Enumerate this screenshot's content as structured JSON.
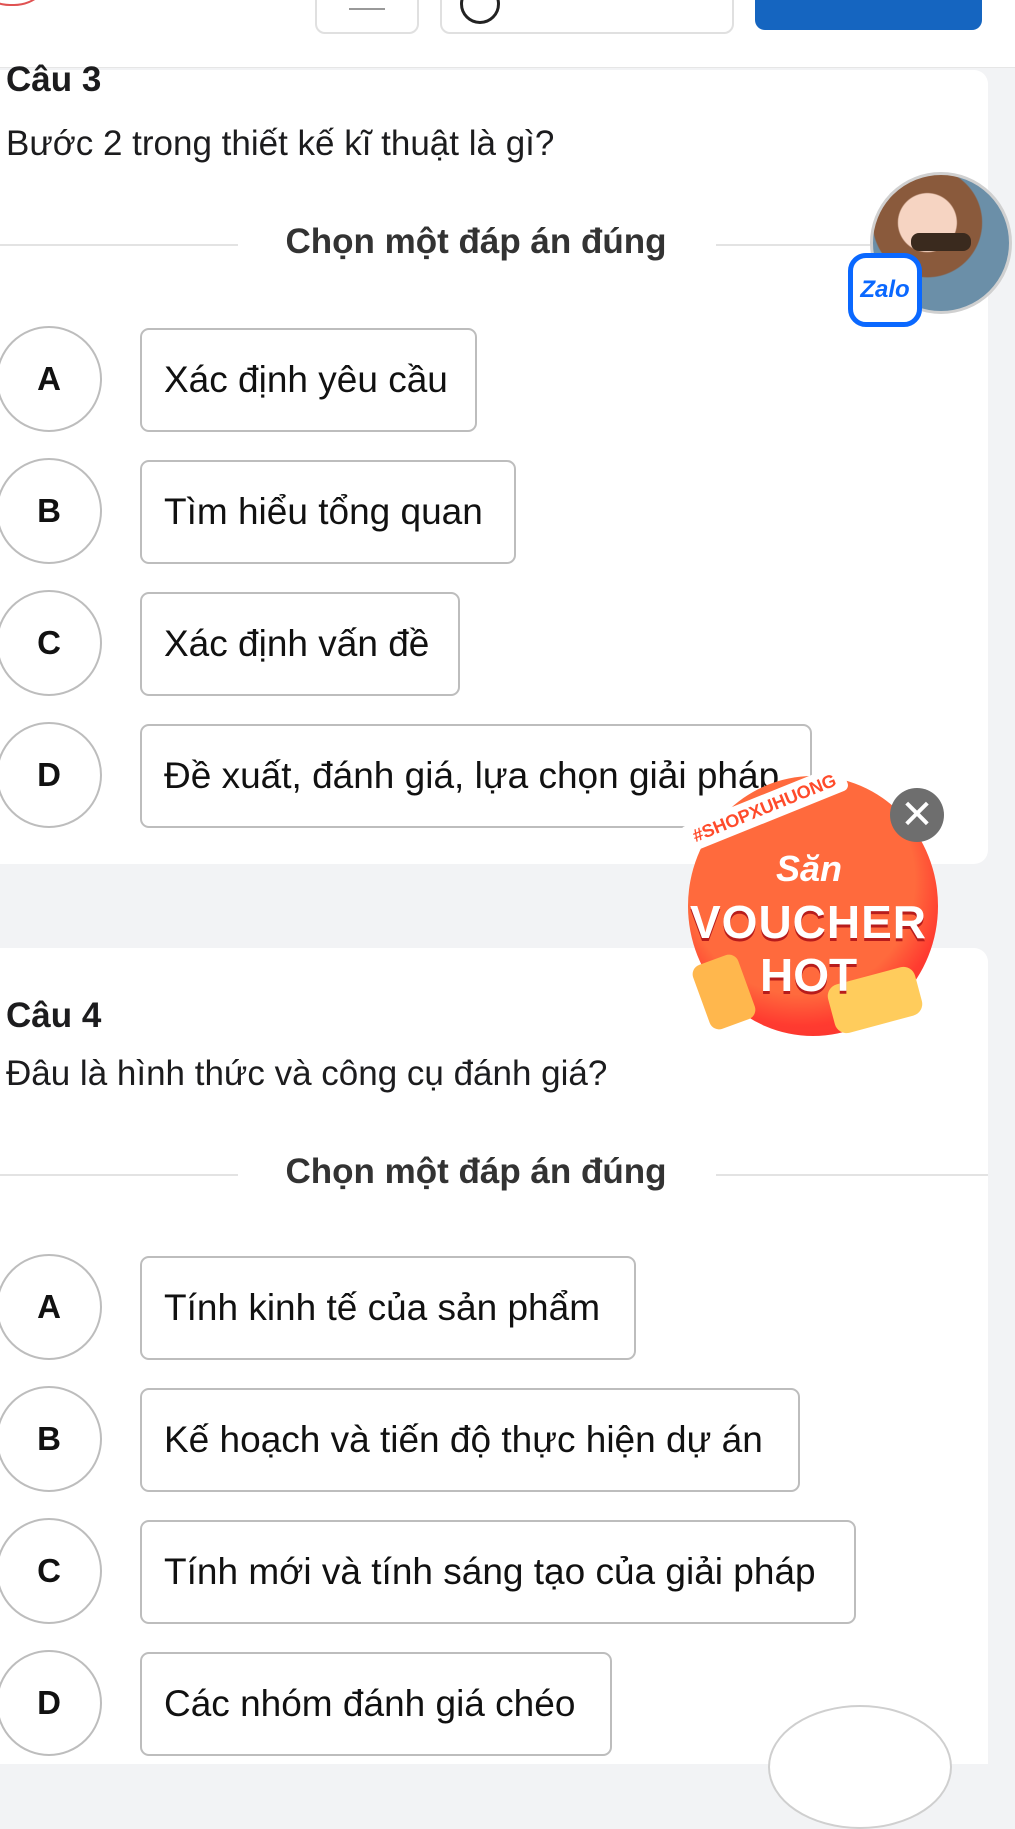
{
  "question3": {
    "title": "Câu 3",
    "text": "Bước 2 trong thiết kế kĩ thuật là gì?",
    "instruction": "Chọn một đáp án đúng",
    "options": [
      {
        "letter": "A",
        "text": "Xác định yêu cầu"
      },
      {
        "letter": "B",
        "text": "Tìm hiểu tổng quan"
      },
      {
        "letter": "C",
        "text": "Xác định vấn đề"
      },
      {
        "letter": "D",
        "text": "Đề xuất, đánh giá, lựa chọn giải pháp"
      }
    ]
  },
  "question4": {
    "title": "Câu 4",
    "text": "Đâu là hình thức và công cụ đánh giá?",
    "instruction": "Chọn một đáp án đúng",
    "options": [
      {
        "letter": "A",
        "text": "Tính kinh tế của sản phẩm"
      },
      {
        "letter": "B",
        "text": "Kế hoạch và tiến độ thực hiện dự án"
      },
      {
        "letter": "C",
        "text": "Tính mới và tính sáng tạo của giải pháp"
      },
      {
        "letter": "D",
        "text": "Các nhóm đánh giá chéo"
      }
    ]
  },
  "zalo_bubble": {
    "label": "Zalo",
    "icon": "zalo-icon",
    "color": "#0a68ff"
  },
  "voucher_ad": {
    "tag": "#SHOPXUHUONG",
    "line1": "Săn",
    "line2": "VOUCHER",
    "line3": "HOT",
    "close_icon": "close-icon",
    "color": "#ff4b2b"
  },
  "colors": {
    "submit_button": "#1565c0",
    "border": "#bdbdbd"
  }
}
